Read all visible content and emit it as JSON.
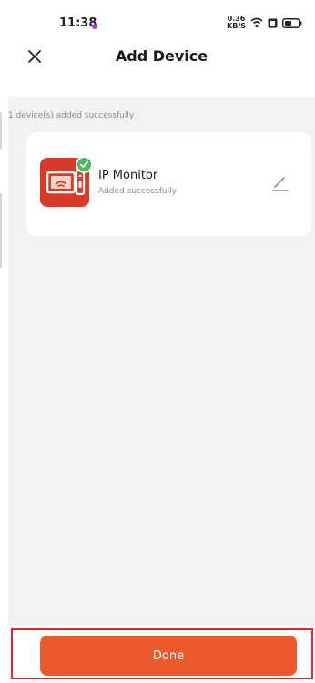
{
  "status_bar": {
    "time": "11:38",
    "speed_value": "0.36",
    "speed_unit": "KB/S",
    "icons": [
      "notification-dot",
      "network-speed",
      "wifi-icon",
      "sim-icon",
      "battery-icon"
    ]
  },
  "header": {
    "title": "Add Device",
    "close_icon": "close-icon"
  },
  "result": {
    "message": "1 device(s) added successfully"
  },
  "device": {
    "name": "IP Monitor",
    "status": "Added successfully",
    "thumbnail_icon": "ip-monitor-icon",
    "badge_icon": "check-icon",
    "edit_icon": "pencil-icon"
  },
  "footer": {
    "done_label": "Done"
  },
  "colors": {
    "accent": "#ea5a2c",
    "success": "#4cb865",
    "highlight": "#e1262d",
    "background": "#f2f2f4"
  }
}
